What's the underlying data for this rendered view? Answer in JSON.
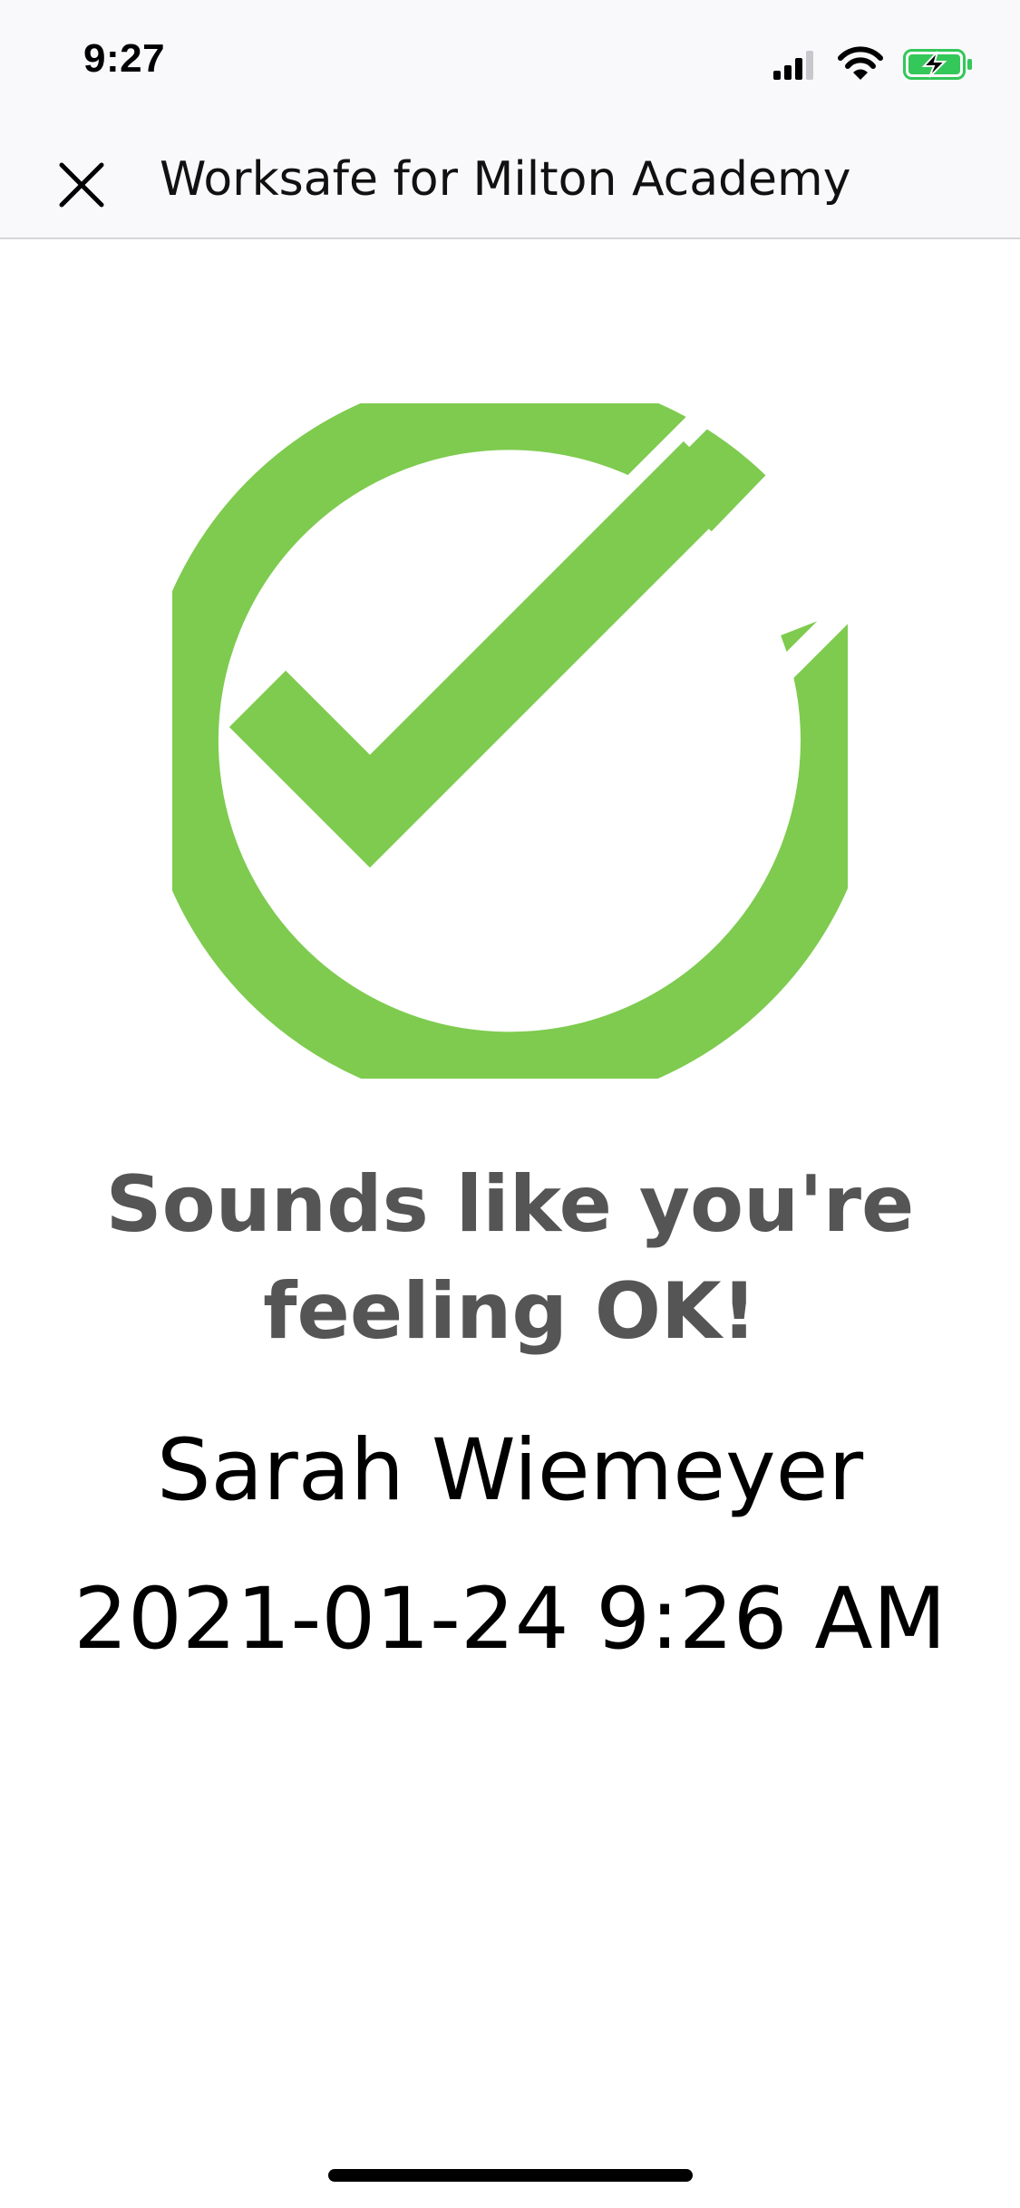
{
  "status_bar": {
    "time": "9:27",
    "icons": [
      "cellular-signal-icon",
      "wifi-icon",
      "battery-charging-icon"
    ],
    "battery_color": "#34c759"
  },
  "nav_bar": {
    "close_icon": "close-icon",
    "title": "Worksafe for Milton Academy"
  },
  "result": {
    "icon": "check-circle-icon",
    "icon_color": "#7ecb4f",
    "headline": "Sounds like you're feeling OK!",
    "name": "Sarah Wiemeyer",
    "timestamp": "2021-01-24 9:26 AM",
    "headline_color": "#555555"
  }
}
